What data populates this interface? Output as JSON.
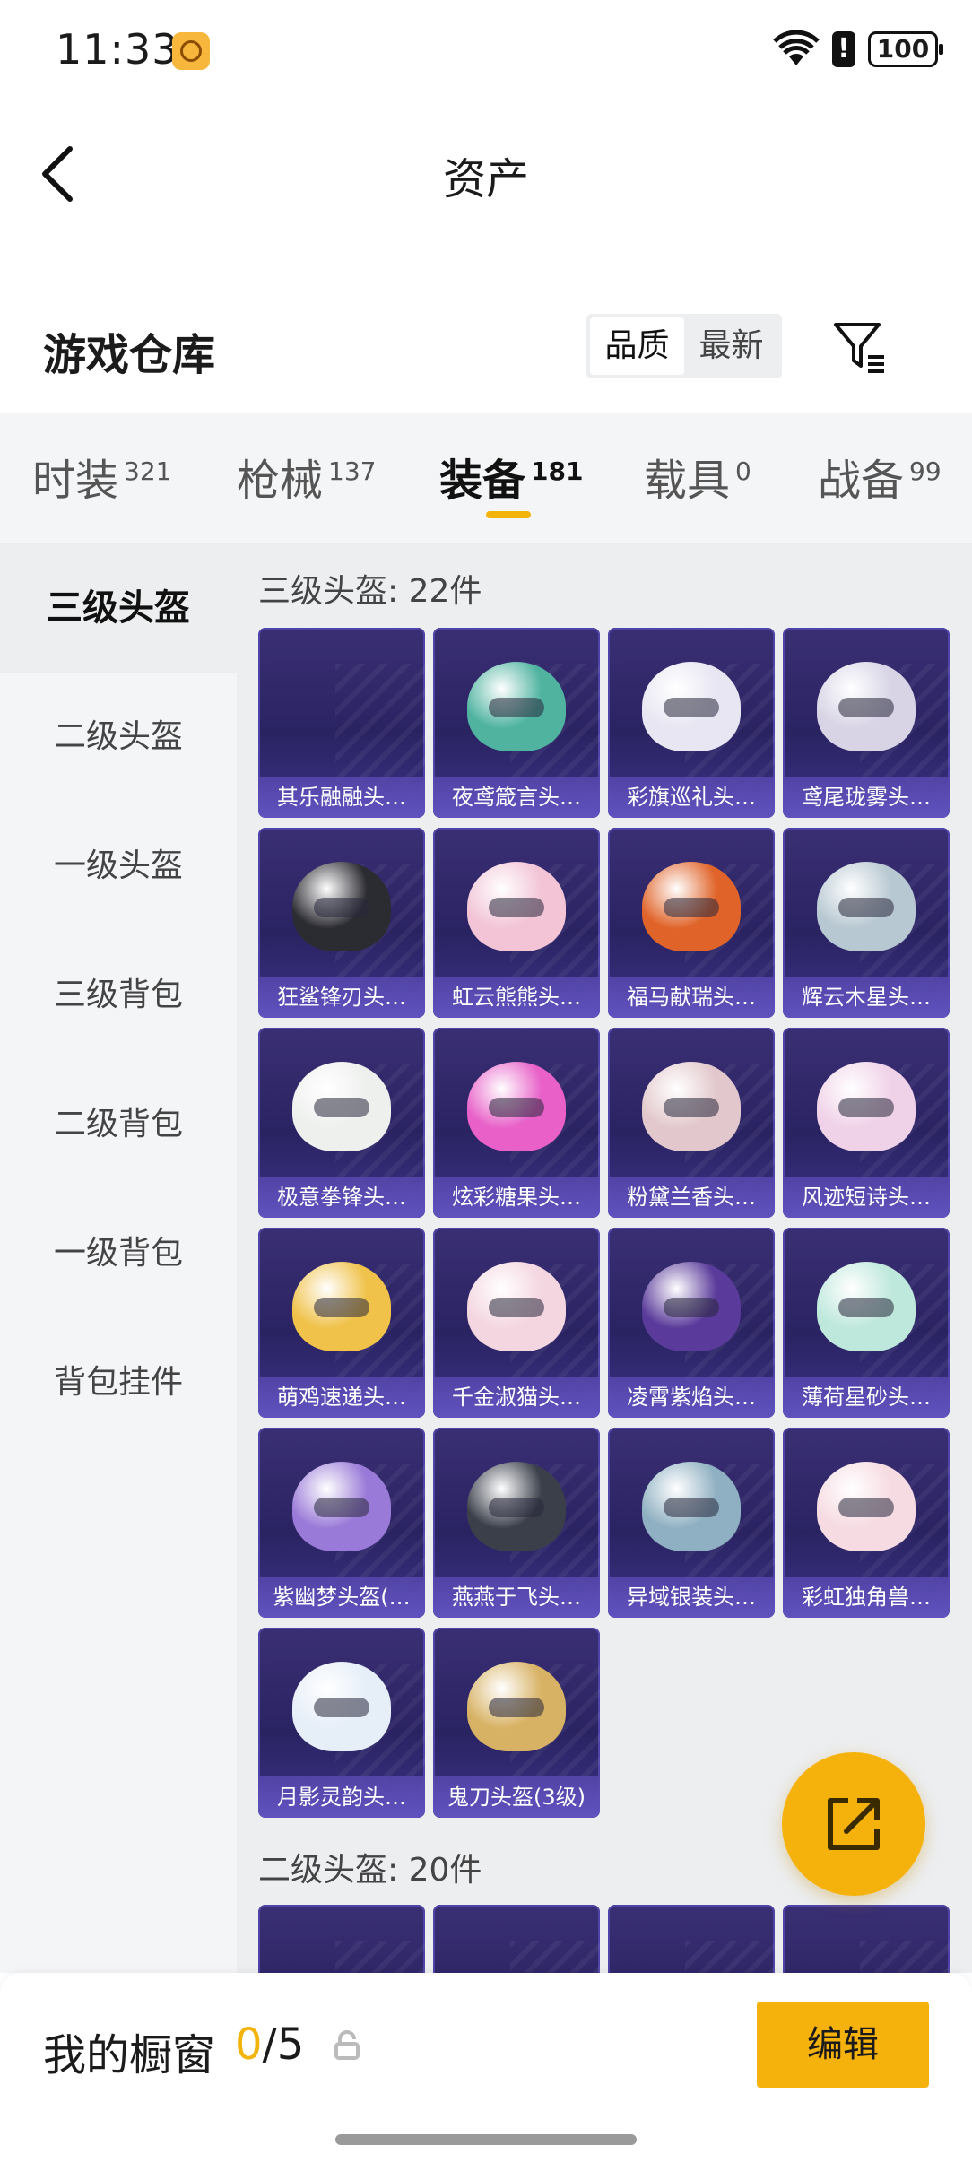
{
  "status_bar": {
    "time": "11:33",
    "battery": "100"
  },
  "header": {
    "title": "资产"
  },
  "warehouse": {
    "title": "游戏仓库",
    "sort_options": [
      "品质",
      "最新"
    ]
  },
  "category_tabs": [
    {
      "label": "时装",
      "count": "321"
    },
    {
      "label": "枪械",
      "count": "137"
    },
    {
      "label": "装备",
      "count": "181"
    },
    {
      "label": "载具",
      "count": "0"
    },
    {
      "label": "战备",
      "count": "99"
    }
  ],
  "sidebar": [
    "三级头盔",
    "二级头盔",
    "一级头盔",
    "三级背包",
    "二级背包",
    "一级背包",
    "背包挂件"
  ],
  "groups": [
    {
      "title": "三级头盔: 22件",
      "items": [
        {
          "name": "其乐融融头…",
          "color": ""
        },
        {
          "name": "夜鸢箴言头…",
          "color": "#4fb3a0"
        },
        {
          "name": "彩旗巡礼头…",
          "color": "#e8e6f2"
        },
        {
          "name": "鸢尾珑雾头…",
          "color": "#d8d4e6"
        },
        {
          "name": "狂鲨锋刃头…",
          "color": "#2b2b32"
        },
        {
          "name": "虹云熊熊头…",
          "color": "#f2c4d6"
        },
        {
          "name": "福马献瑞头…",
          "color": "#e0642a"
        },
        {
          "name": "辉云木星头…",
          "color": "#b8c8d2"
        },
        {
          "name": "极意拳锋头…",
          "color": "#eef0ee"
        },
        {
          "name": "炫彩糖果头…",
          "color": "#e860c8"
        },
        {
          "name": "粉黛兰香头…",
          "color": "#e2c8cc"
        },
        {
          "name": "风迹短诗头…",
          "color": "#f0d2e8"
        },
        {
          "name": "萌鸡速递头…",
          "color": "#f0c24a"
        },
        {
          "name": "千金淑猫头…",
          "color": "#f4d6e0"
        },
        {
          "name": "凌霄紫焰头…",
          "color": "#5a3a9a"
        },
        {
          "name": "薄荷星砂头…",
          "color": "#bfe8dc"
        },
        {
          "name": "紫幽梦头盔(…",
          "color": "#9a7ad8"
        },
        {
          "name": "燕燕于飞头…",
          "color": "#3a3f4a"
        },
        {
          "name": "异域银装头…",
          "color": "#8fb0c2"
        },
        {
          "name": "彩虹独角兽…",
          "color": "#f6dbe2"
        },
        {
          "name": "月影灵韵头…",
          "color": "#e6eef8"
        },
        {
          "name": "鬼刀头盔(3级)",
          "color": "#d8b264"
        }
      ]
    },
    {
      "title": "二级头盔: 20件"
    }
  ],
  "bottom_bar": {
    "label": "我的橱窗",
    "count_current": "0",
    "count_total": "/5",
    "edit_label": "编辑"
  }
}
